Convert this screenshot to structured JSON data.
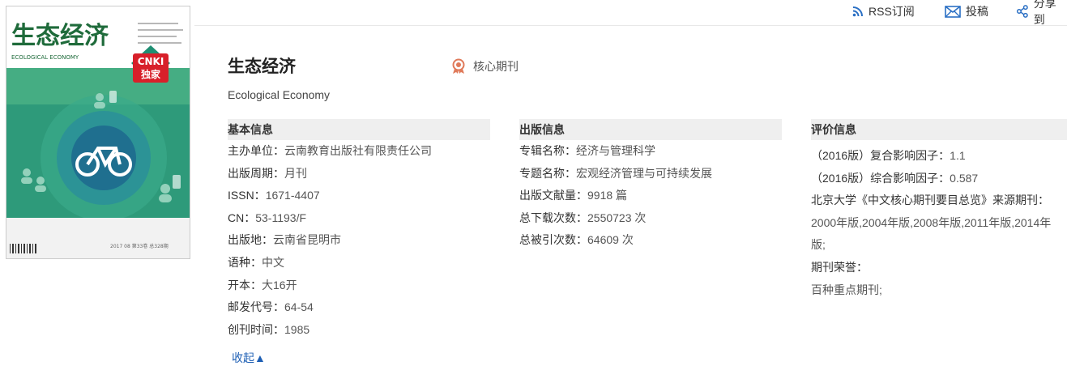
{
  "toolbar": {
    "rss_label": "RSS订阅",
    "submit_label": "投稿",
    "share_label": "分享到"
  },
  "cover": {
    "title_cn": "生态经济",
    "title_en": "ECOLOGICAL   ECONOMY",
    "badge_top": "CNKI",
    "badge_bottom": "独家",
    "issue_text": "2017  08  第33卷  总328期"
  },
  "journal": {
    "title": "生态经济",
    "english_title": "Ecological Economy",
    "core_label": "核心期刊"
  },
  "basic_info": {
    "heading": "基本信息",
    "items": [
      {
        "label": "主办单位：",
        "value": "云南教育出版社有限责任公司"
      },
      {
        "label": "出版周期：",
        "value": "月刊"
      },
      {
        "label": "ISSN：",
        "value": "1671-4407"
      },
      {
        "label": "CN：",
        "value": "53-1193/F"
      },
      {
        "label": "出版地：",
        "value": "云南省昆明市"
      },
      {
        "label": "语种：",
        "value": "中文"
      },
      {
        "label": "开本：",
        "value": "大16开"
      },
      {
        "label": "邮发代号：",
        "value": "64-54"
      },
      {
        "label": "创刊时间：",
        "value": "1985"
      }
    ]
  },
  "publish_info": {
    "heading": "出版信息",
    "items": [
      {
        "label": "专辑名称：",
        "value": "经济与管理科学"
      },
      {
        "label": "专题名称：",
        "value": "宏观经济管理与可持续发展"
      },
      {
        "label": "出版文献量：",
        "value": "9918 篇"
      },
      {
        "label": "总下载次数：",
        "value": "2550723 次"
      },
      {
        "label": "总被引次数：",
        "value": "64609 次"
      }
    ]
  },
  "evaluation_info": {
    "heading": "评价信息",
    "impact_composite_label": "（2016版）复合影响因子：",
    "impact_composite_value": "1.1",
    "impact_comprehensive_label": "（2016版）综合影响因子：",
    "impact_comprehensive_value": "0.587",
    "pku_label": "北京大学《中文核心期刊要目总览》来源期刊：",
    "pku_line1": "2000年版,2004年版,2008年版,2011年版,2014年",
    "pku_line2": "版;",
    "honors_label": "期刊荣誉：",
    "honors_value": "百种重点期刊;"
  },
  "collapse_label": "收起",
  "colors": {
    "link_blue": "#1e5fb4",
    "header_bg": "#efefef",
    "cover_green": "#2e9a7a",
    "badge_red": "#d8202a"
  }
}
